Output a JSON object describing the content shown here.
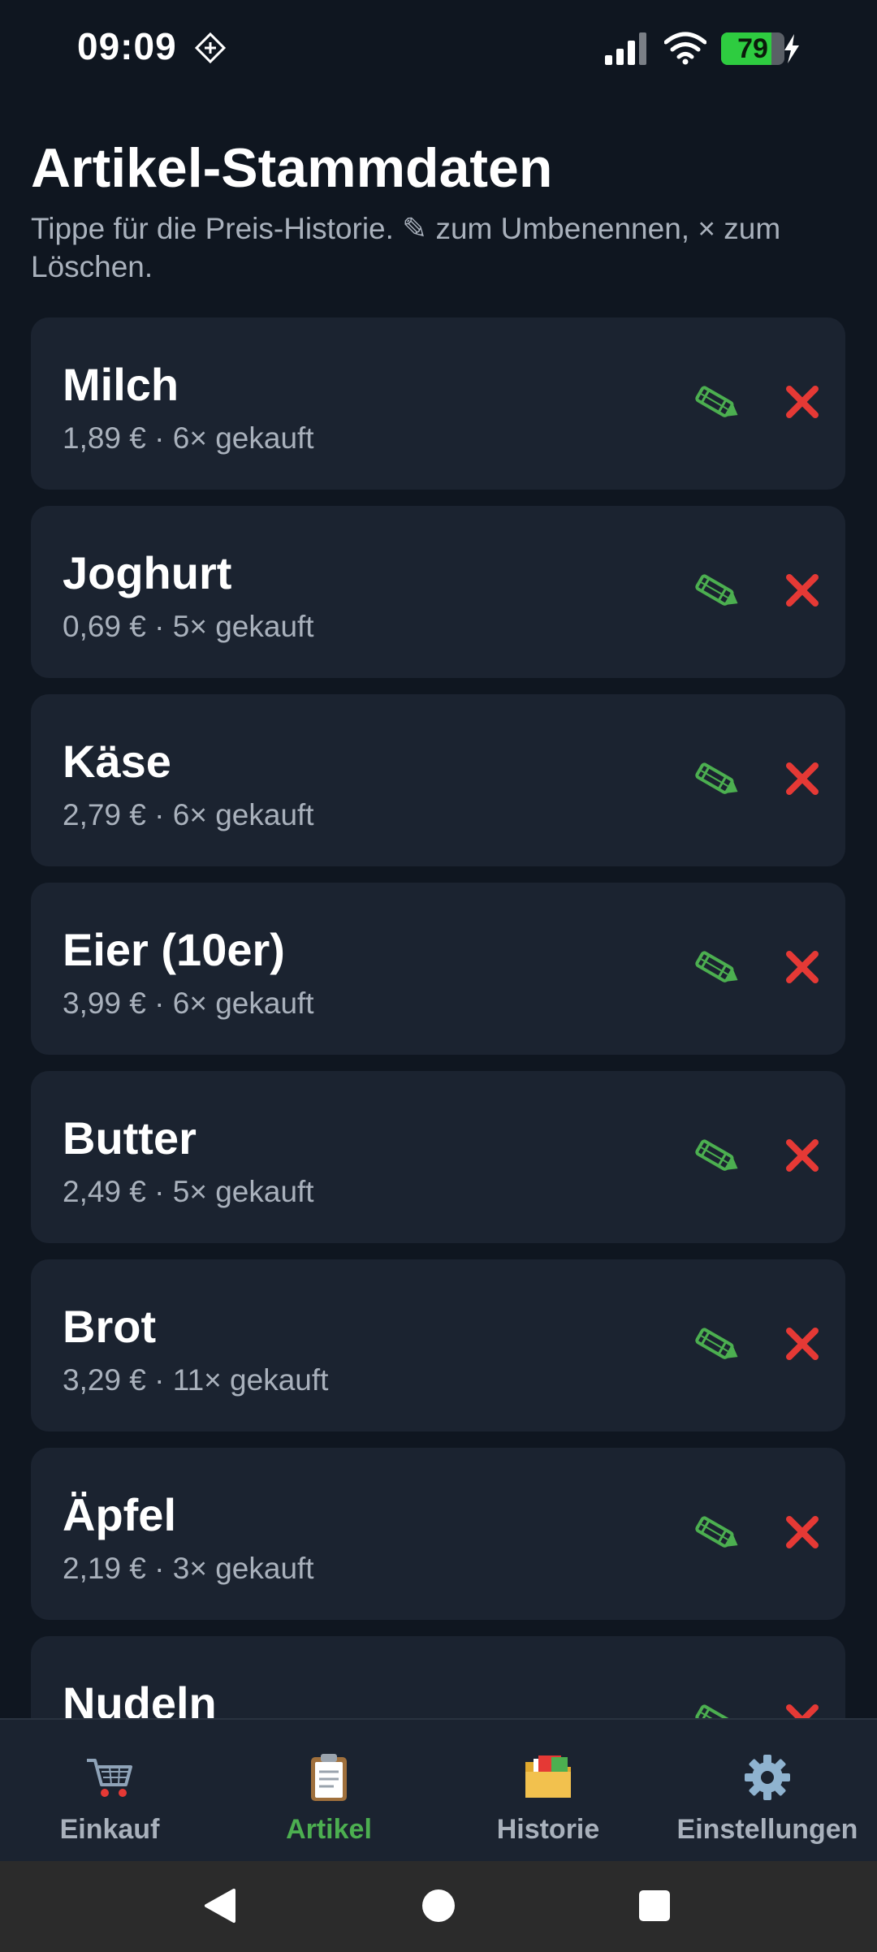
{
  "status_bar": {
    "time": "09:09",
    "battery_level": "79",
    "battery_fraction": 0.79
  },
  "header": {
    "title": "Artikel-Stammdaten",
    "subtitle": "Tippe für die Preis-Historie. ✎ zum Umbenennen, × zum Löschen."
  },
  "articles": [
    {
      "name": "Milch",
      "meta": "1,89 € · 6× gekauft"
    },
    {
      "name": "Joghurt",
      "meta": "0,69 € · 5× gekauft"
    },
    {
      "name": "Käse",
      "meta": "2,79 € · 6× gekauft"
    },
    {
      "name": "Eier (10er)",
      "meta": "3,99 € · 6× gekauft"
    },
    {
      "name": "Butter",
      "meta": "2,49 € · 5× gekauft"
    },
    {
      "name": "Brot",
      "meta": "3,29 € · 11× gekauft"
    },
    {
      "name": "Äpfel",
      "meta": "2,19 € · 3× gekauft"
    },
    {
      "name": "Nudeln",
      "meta": ""
    }
  ],
  "colors": {
    "background": "#0f1620",
    "card": "#1b2330",
    "accent": "#4caf50",
    "delete": "#e53935",
    "muted_text": "#a9b1bc"
  },
  "bottom_nav": {
    "items": [
      {
        "label": "Einkauf",
        "icon": "shopping-cart-icon",
        "active": false
      },
      {
        "label": "Artikel",
        "icon": "clipboard-icon",
        "active": true
      },
      {
        "label": "Historie",
        "icon": "folder-icon",
        "active": false
      },
      {
        "label": "Einstellungen",
        "icon": "gear-icon",
        "active": false
      }
    ]
  }
}
